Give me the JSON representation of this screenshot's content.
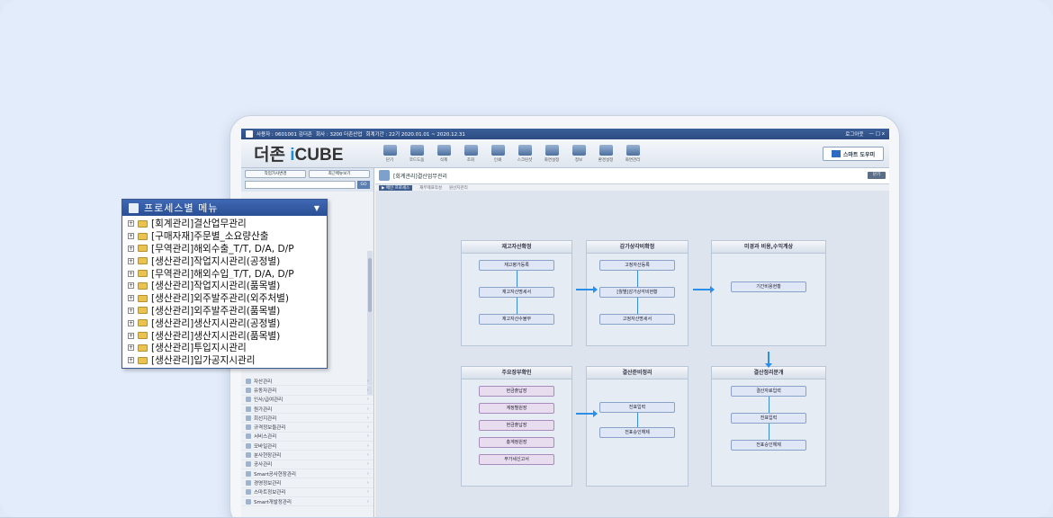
{
  "titlebar": {
    "user": "사용자 : 0601001 김더존",
    "company": "회사 : 3200 더존산업",
    "period": "회계기간 : 22기 2020.01.01 ~ 2020.12.31",
    "logout": "로그아웃",
    "controls": "— □ x"
  },
  "brand": {
    "prefix": "더존 ",
    "i": "i",
    "suffix": "CUBE"
  },
  "toolbar": [
    "닫기",
    "코드도움",
    "삭제",
    "조회",
    "인쇄",
    "스크린샷",
    "화면설정",
    "정보",
    "환경설정",
    "화면관리"
  ],
  "help_button": "스마트 도우미",
  "sidebar": {
    "btn1": "작업가사변경",
    "btn2": "최근메뉴보기",
    "go": "GO",
    "items": [
      "자산관리",
      "유동자관리",
      "인사/급여관리",
      "원가관리",
      "회선지관리",
      "규격정보들관리",
      "서비스관리",
      "모바일관리",
      "분사현장관리",
      "공사관리",
      "Smart공사현장관리",
      "경영정보관리",
      "스마트정보관리",
      "Smart개발정관리"
    ]
  },
  "main": {
    "title": "[회계관리]결산업무관리",
    "close": "닫기",
    "tabs": [
      "▶ 메인 프로세스",
      "재무제표작성",
      "원산지관리"
    ]
  },
  "flow": {
    "col1": {
      "title": "재고자산확정",
      "items": [
        "재고평가등록",
        "재고자산명세서",
        "재고자산수불부"
      ]
    },
    "col2": {
      "title": "감가상각비확정",
      "items": [
        "고정자산등록",
        "[월별]감가상각비현황",
        "고정자산명세서"
      ]
    },
    "col3": {
      "title": "미경과 비용,수익계상",
      "items": [
        "기간비용현황"
      ]
    },
    "col4": {
      "title": "주요장부확인",
      "items": [
        "현금출납장",
        "계정별원장",
        "현금출납장",
        "총계정원장",
        "부가세신고서"
      ]
    },
    "col5": {
      "title": "결산준비정리",
      "items": [
        "전표입력",
        "전표승인해제"
      ]
    },
    "col6": {
      "title": "결산정리분개",
      "items": [
        "결산자료입력",
        "전표입력",
        "전표승인해제"
      ]
    }
  },
  "popup": {
    "title": "프로세스별 메뉴",
    "items": [
      "[회계관리]결산업무관리",
      "[구매자재]주문별_소요량산출",
      "[무역관리]해외수출_T/T, D/A, D/P",
      "[생산관리]작업지시관리(공정별)",
      "[무역관리]해외수입_T/T, D/A, D/P",
      "[생산관리]작업지시관리(품목별)",
      "[생산관리]외주발주관리(외주처별)",
      "[생산관리]외주발주관리(품목별)",
      "[생산관리]생산지시관리(공정별)",
      "[생산관리]생산지시관리(품목별)",
      "[생산관리]투입지시관리",
      "[생산관리]입가공지시관리"
    ]
  }
}
